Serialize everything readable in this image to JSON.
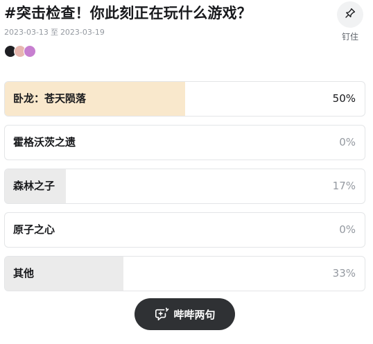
{
  "header": {
    "title": "#突击检查！你此刻正在玩什么游戏？",
    "date_start": "2023-03-13",
    "date_sep": "至",
    "date_end": "2023-03-19"
  },
  "participants": {
    "avatars": [
      {
        "name": "avatar-1",
        "color": "#1f1f23"
      },
      {
        "name": "avatar-2",
        "color": "#e7b7b0"
      },
      {
        "name": "avatar-3",
        "color": "#c77fd0"
      }
    ]
  },
  "pin": {
    "icon": "pin-icon",
    "label": "钉住"
  },
  "poll": {
    "options": [
      {
        "label": "卧龙：苍天陨落",
        "percent": "50%",
        "fraction": 0.5,
        "top": true
      },
      {
        "label": "霍格沃茨之遗",
        "percent": "0%",
        "fraction": 0.0,
        "top": false
      },
      {
        "label": "森林之子",
        "percent": "17%",
        "fraction": 0.17,
        "top": false
      },
      {
        "label": "原子之心",
        "percent": "0%",
        "fraction": 0.0,
        "top": false
      },
      {
        "label": "其他",
        "percent": "33%",
        "fraction": 0.33,
        "top": false
      }
    ]
  },
  "chat_button": {
    "label": "哔哔两句",
    "icon": "chat-bubble-add-icon"
  },
  "colors": {
    "top_fill": "#f9e8cc",
    "other_fill": "#ebebeb",
    "button_bg": "#2f3134"
  }
}
